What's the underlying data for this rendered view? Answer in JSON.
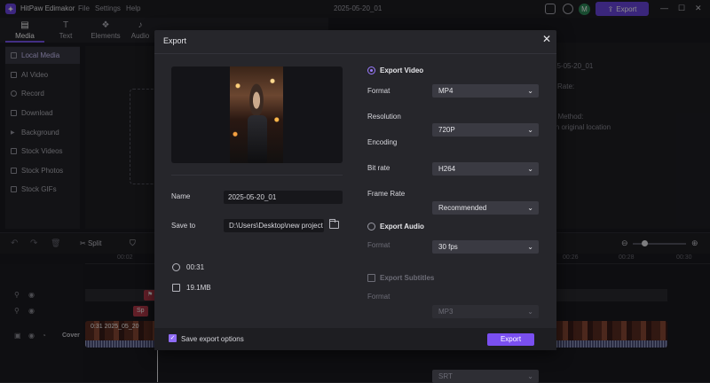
{
  "app": {
    "name": "HitPaw Edimakor",
    "menus": [
      "File",
      "Settings",
      "Help"
    ],
    "doc_title": "2025-05-20_01",
    "avatar_letter": "M",
    "export_label": "Export"
  },
  "toolbar": {
    "tabs": [
      {
        "label": "Media",
        "icon": "media-icon"
      },
      {
        "label": "Text",
        "icon": "text-icon"
      },
      {
        "label": "Elements",
        "icon": "elements-icon"
      },
      {
        "label": "Audio",
        "icon": "audio-icon"
      }
    ]
  },
  "sidebar": {
    "items": [
      {
        "label": "Local Media",
        "icon": "folder-icon"
      },
      {
        "label": "AI Video",
        "icon": "ai-icon"
      },
      {
        "label": "Record",
        "icon": "record-icon"
      },
      {
        "label": "Download",
        "icon": "download-icon"
      },
      {
        "label": "Background",
        "icon": "background-icon"
      },
      {
        "label": "Stock Videos",
        "icon": "video-icon"
      },
      {
        "label": "Stock Photos",
        "icon": "photo-icon"
      },
      {
        "label": "Stock GIFs",
        "icon": "gif-icon"
      }
    ]
  },
  "right_panel": {
    "lines": [
      "25-05-20_01",
      "Rate:",
      "t Method:",
      "in original location"
    ]
  },
  "timeline": {
    "split_label": "Split",
    "ruler": [
      "00:02",
      "00:26",
      "00:28",
      "00:30"
    ],
    "cover_label": "Cover",
    "clip_label": "0:31  2025_05_20",
    "tag_label": "Sp"
  },
  "dialog": {
    "title": "Export",
    "name_label": "Name",
    "name_value": "2025-05-20_01",
    "save_to_label": "Save to",
    "save_to_value": "D:\\Users\\Desktop\\new project",
    "duration": "00:31",
    "file_size": "19.1MB",
    "export_video": {
      "title": "Export Video",
      "selected": true,
      "rows": [
        {
          "label": "Format",
          "value": "MP4"
        },
        {
          "label": "Resolution",
          "value": "720P"
        },
        {
          "label": "Encoding",
          "value": "H264"
        },
        {
          "label": "Bit rate",
          "value": "Recommended"
        },
        {
          "label": "Frame Rate",
          "value": "30  fps"
        }
      ]
    },
    "export_audio": {
      "title": "Export Audio",
      "selected": false,
      "format_label": "Format",
      "format_value": "MP3"
    },
    "export_subtitles": {
      "title": "Export Subtitles",
      "checked": false,
      "format_label": "Format",
      "format_value": "SRT"
    },
    "save_options_label": "Save export options",
    "save_options_checked": true,
    "export_button": "Export"
  },
  "colors": {
    "accent": "#7a4ff0",
    "background": "#1b1b1f",
    "dialog": "#26262b"
  }
}
